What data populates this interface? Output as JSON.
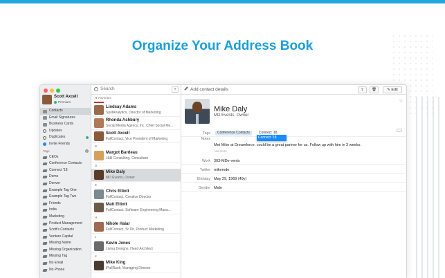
{
  "headline": "Organize Your Address Book",
  "colors": {
    "accent": "#1b9fd9",
    "selection": "#1a8cff",
    "premium_dot": "#36b37e"
  },
  "user": {
    "name": "Scott Axcell",
    "plan": "Premium"
  },
  "sidebar": {
    "items": [
      {
        "label": "Contacts",
        "icon": "contacts-icon",
        "selected": true
      },
      {
        "label": "Email Signatures",
        "icon": "signature-icon"
      },
      {
        "label": "Business Cards",
        "icon": "business-card-icon"
      },
      {
        "label": "Updates",
        "icon": "updates-icon"
      },
      {
        "label": "Duplicates",
        "icon": "duplicates-icon"
      },
      {
        "label": "Invite Friends",
        "icon": "invite-icon"
      }
    ],
    "tags_header": "Tags",
    "tags": [
      "CEOs",
      "Conference Contacts",
      "Connect '18",
      "Demo",
      "Denver",
      "Example Tag One",
      "Example Tag Two",
      "Friends",
      "India",
      "Marketing",
      "Product Management",
      "Scott's Contacts",
      "Venture Capital",
      "Missing Name",
      "Missing Organization",
      "Missing Tag",
      "No Email",
      "No Phone"
    ]
  },
  "list": {
    "search_placeholder": "Search",
    "add_label": "+",
    "favorites_label": "★ Favorites",
    "sections": [
      {
        "letter": "",
        "rows": [
          {
            "name": "Lindsay Adams",
            "sub": "SpotAnalytics, Director of Marketing",
            "color": "#9b6a4a"
          },
          {
            "name": "Rhonda Ashbury",
            "sub": "Social Media Agency, Inc, Chief Social Me...",
            "color": "#b07a5a"
          },
          {
            "name": "Scott Axcell",
            "sub": "FullContact, Vice President of Marketing",
            "color": "#8a5a3a"
          }
        ]
      },
      {
        "letter": "B",
        "rows": [
          {
            "name": "Margot Bardeau",
            "sub": "J&B Consulting, Consultant",
            "color": "#d4a15a"
          }
        ]
      },
      {
        "letter": "D",
        "rows": [
          {
            "name": "Mike Daly",
            "sub": "MD Events, Owner",
            "color": "#5a3a28",
            "selected": true
          }
        ]
      },
      {
        "letter": "E",
        "rows": [
          {
            "name": "Chris Elliott",
            "sub": "FullContact, Creative Director",
            "color": "#7d8a94"
          },
          {
            "name": "Matt Elliott",
            "sub": "FullContact, Software Engineering Mana...",
            "color": "#6b5a4a"
          }
        ]
      },
      {
        "letter": "H",
        "rows": [
          {
            "name": "Nikole Haiar",
            "sub": "FullContact, Sr Dir, Product Marketing",
            "color": "#a06a50"
          }
        ]
      },
      {
        "letter": "J",
        "rows": [
          {
            "name": "Kevin Jones",
            "sub": "Living Designs, Head Architect",
            "color": "#6a6a6a"
          }
        ]
      },
      {
        "letter": "K",
        "rows": [
          {
            "name": "Mike King",
            "sub": "iPullRank, Managing Director",
            "color": "#4a3a30"
          }
        ]
      }
    ]
  },
  "detail": {
    "toolbar_placeholder": "Add contact details",
    "edit_label": "Edit",
    "name": "Mike Daly",
    "subtitle": "MD Events, Owner",
    "tags_label": "Tags",
    "tags": [
      "Conference Contacts",
      "Connect '18"
    ],
    "dropdown_option": "Connect '18",
    "notes_label": "Notes",
    "note": "Met Mike at Dreamforce, could be a great partner for us. Follow up with him in 3 weeks.",
    "add_note": "Add Note",
    "fields": [
      {
        "label": "Work",
        "value": "303-MDe-vents"
      },
      {
        "label": "Twitter",
        "value": "mikemde"
      },
      {
        "label": "Birthday",
        "value": "May 29, 1969 (49y)"
      },
      {
        "label": "Gender",
        "value": "Male"
      }
    ]
  }
}
